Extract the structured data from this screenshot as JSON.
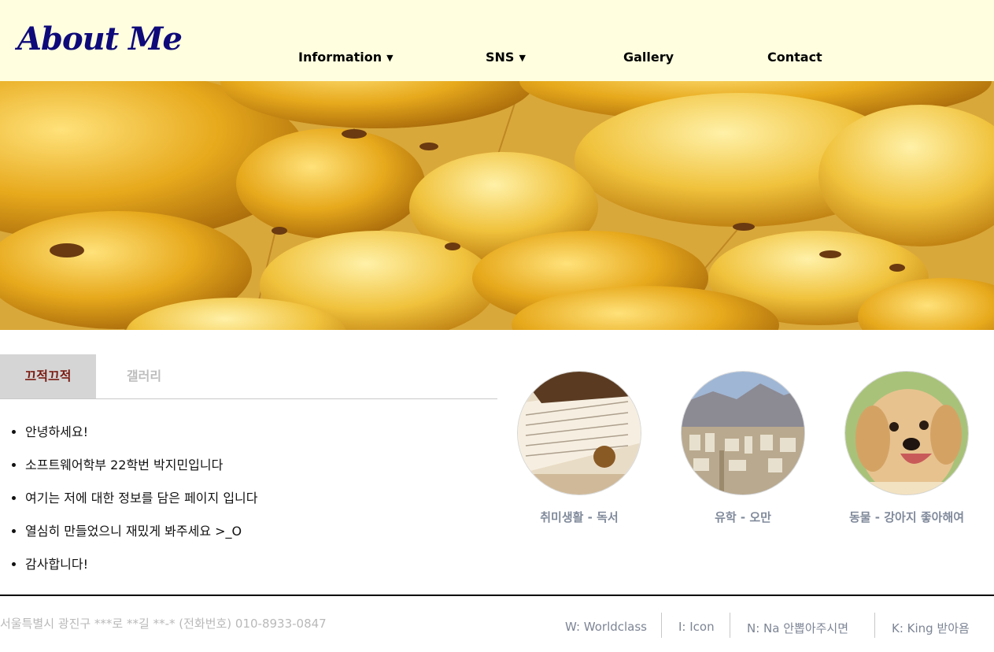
{
  "header": {
    "logo": "About Me",
    "nav": [
      {
        "label": "Information",
        "caret": "▼"
      },
      {
        "label": "SNS",
        "caret": "▼"
      },
      {
        "label": "Gallery"
      },
      {
        "label": "Contact"
      }
    ]
  },
  "hero": {
    "image": "yellow-balloons-photo"
  },
  "tabs": [
    {
      "label": "끄적끄적",
      "active": true
    },
    {
      "label": "갤러리",
      "active": false
    }
  ],
  "intro": {
    "items": [
      "안녕하세요!",
      "소프트웨어학부 22학번 박지민입니다",
      "여기는 저에 대한 정보를 담은 페이지 입니다",
      "열심히 만들었으니 재밌게 봐주세요 >_O",
      "감사합니다!"
    ]
  },
  "gallery": [
    {
      "label": "취미생활 - 독서",
      "image": "open-book-photo"
    },
    {
      "label": "유학 - 오만",
      "image": "city-mountains-photo"
    },
    {
      "label": "동물 - 강아지 좋아해여",
      "image": "puppy-photo"
    }
  ],
  "footer": {
    "address": "서울특별시 광진구 ***로 **길 **-* (전화번호) 010-8933-0847",
    "links": [
      "W: Worldclass",
      "I: Icon",
      "N: Na 안뽑아주시면",
      "K: King 받아욤"
    ]
  },
  "colors": {
    "header_bg": "#ffffdf",
    "logo": "#0f0a7a",
    "active_tab_text": "#7a1b13",
    "active_tab_bg": "#d5d5d5",
    "caption": "#808a9b"
  }
}
